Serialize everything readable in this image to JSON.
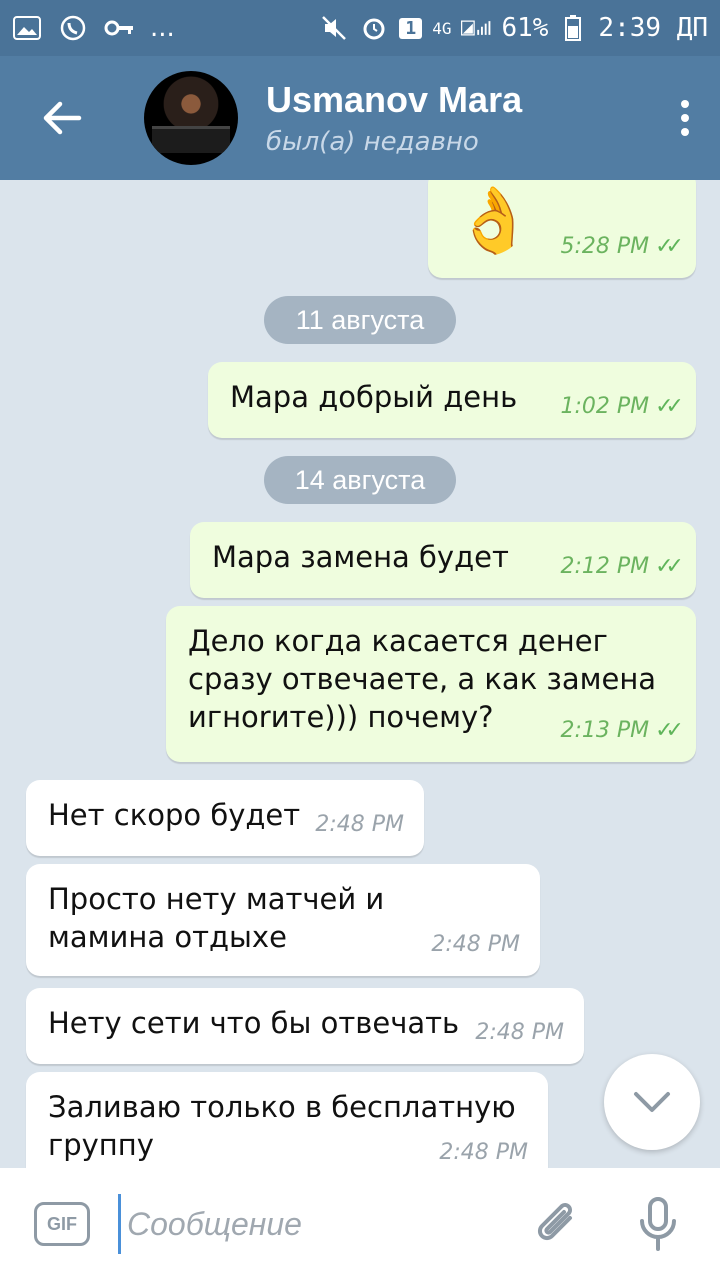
{
  "statusbar": {
    "left_icons": [
      "image-icon",
      "whatsapp-icon",
      "key-icon"
    ],
    "more": "...",
    "sim": "1",
    "network": "4G",
    "battery": "61%",
    "time": "2:39 ДП"
  },
  "header": {
    "name": "Usmanov Mara",
    "status": "был(а) недавно"
  },
  "messages": [
    {
      "type": "out",
      "text": "👌",
      "time": "5:28 PM"
    },
    {
      "type": "date",
      "text": "11 августа"
    },
    {
      "type": "out",
      "text": "Мара добрый день",
      "time": "1:02 PM"
    },
    {
      "type": "date",
      "text": "14 августа"
    },
    {
      "type": "out",
      "text": "Мара замена будет",
      "time": "2:12 PM"
    },
    {
      "type": "out",
      "text": "Дело когда касается денег сразу отвечаете, а как замена игноrите))) почему?",
      "time": "2:13 PM"
    },
    {
      "type": "in",
      "text": "Нет скоро будет",
      "time": "2:48 PM"
    },
    {
      "type": "in",
      "text": "Просто нету матчей и мамина отдыхе",
      "time": "2:48 PM"
    },
    {
      "type": "in",
      "text": "Нету сети что бы отвечать",
      "time": "2:48 PM"
    },
    {
      "type": "in",
      "text": "Заливаю только в бесплатную группу",
      "time": "2:48 PM"
    }
  ],
  "input": {
    "gif_label": "GIF",
    "placeholder": "Сообщение"
  },
  "colors": {
    "header": "#527da3",
    "statusbar": "#4a7398",
    "outgoing": "#effdde",
    "incoming": "#ffffff",
    "background": "#dbe4ec"
  }
}
